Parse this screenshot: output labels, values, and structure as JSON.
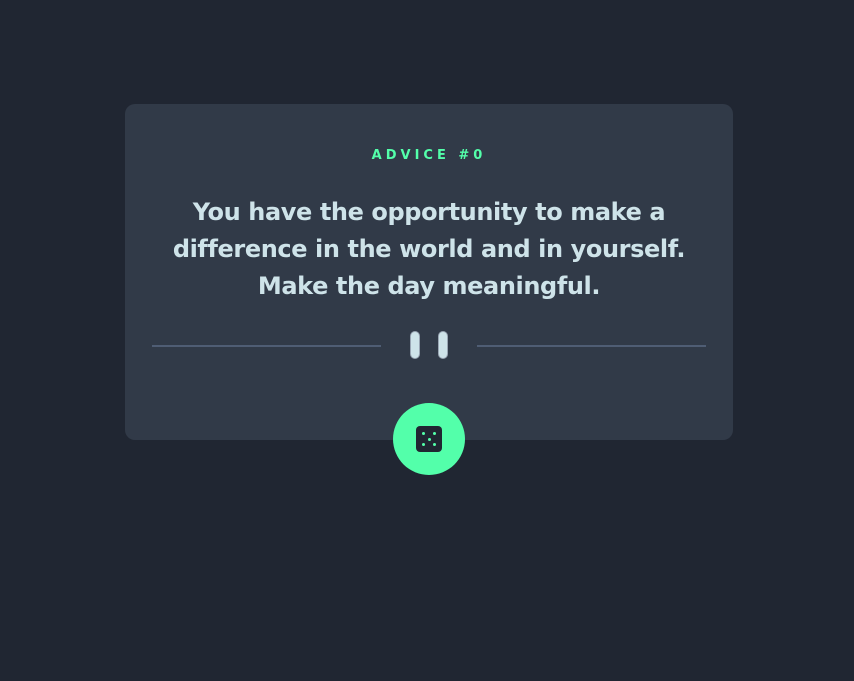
{
  "card": {
    "advice_label": "ADVICE #0",
    "quote_line_1": "You have the opportunity to make a",
    "quote_line_2": "difference in the world and in yourself.",
    "quote_line_3": "Make the day meaningful."
  },
  "divider": {
    "icon": "pause-icon"
  },
  "dice_button": {
    "icon": "dice-icon"
  },
  "colors": {
    "background": "#202632",
    "card": "#313a48",
    "accent": "#53ffaa",
    "text": "#cee3e9",
    "divider": "#4f5d74"
  }
}
